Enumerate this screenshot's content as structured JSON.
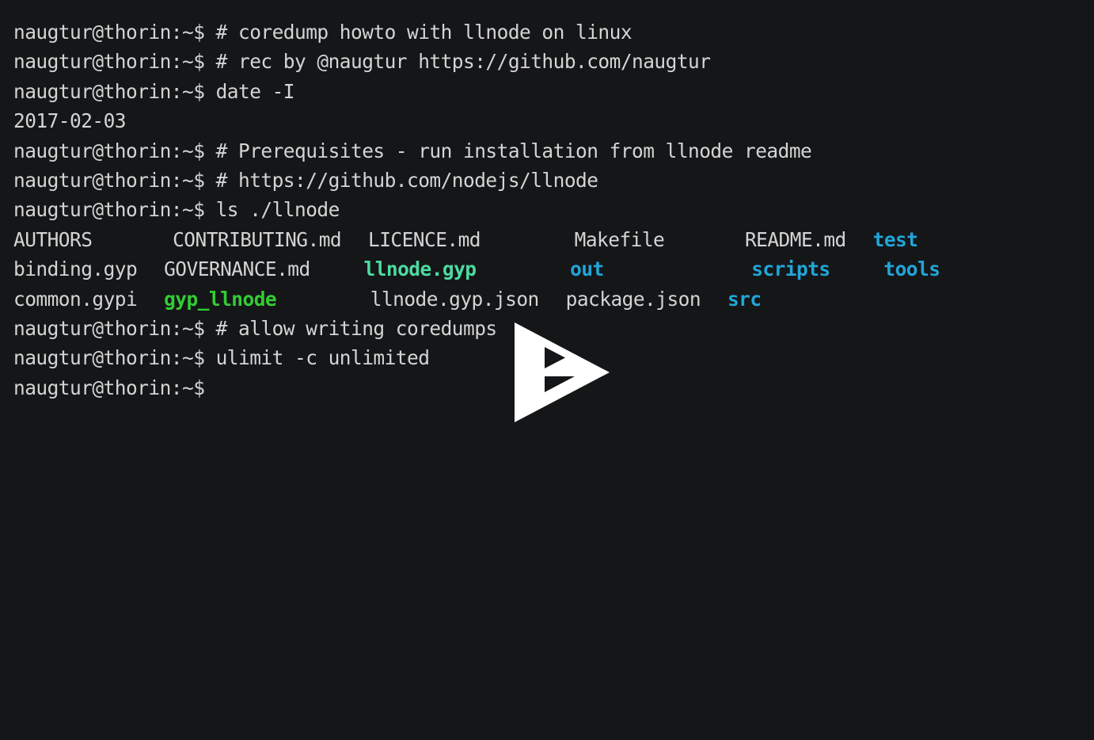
{
  "terminal": {
    "prompt": "naugtur@thorin:~$",
    "background_color": "#141618",
    "foreground_color": "#d4d4d4",
    "colors": {
      "directory": "#22a5d8",
      "symlink": "#4ddba0",
      "executable": "#33cc33",
      "text": "#d4d4d4"
    },
    "lines": [
      {
        "id": "line-1",
        "kind": "command",
        "prompt": "naugtur@thorin:~$",
        "command": " # coredump howto with llnode on linux"
      },
      {
        "id": "line-2",
        "kind": "command",
        "prompt": "naugtur@thorin:~$",
        "command": " # rec by @naugtur https://github.com/naugtur"
      },
      {
        "id": "line-3",
        "kind": "command",
        "prompt": "naugtur@thorin:~$",
        "command": " date -I"
      },
      {
        "id": "line-4",
        "kind": "output",
        "text": "2017-02-03"
      },
      {
        "id": "line-5",
        "kind": "command",
        "prompt": "naugtur@thorin:~$",
        "command": " # Prerequisites - run installation from llnode readme"
      },
      {
        "id": "line-6",
        "kind": "command",
        "prompt": "naugtur@thorin:~$",
        "command": " # https://github.com/nodejs/llnode"
      },
      {
        "id": "line-7",
        "kind": "command",
        "prompt": "naugtur@thorin:~$",
        "command": " ls ./llnode"
      },
      {
        "id": "line-8",
        "kind": "ls-row",
        "cells": [
          {
            "text": "AUTHORS",
            "type": "text",
            "col": 0
          },
          {
            "text": "CONTRIBUTING.md",
            "type": "text",
            "col": 13
          },
          {
            "text": "LICENCE.md",
            "type": "text",
            "col": 30
          },
          {
            "text": "Makefile",
            "type": "text",
            "col": 47
          },
          {
            "text": "README.md",
            "type": "text",
            "col": 61
          },
          {
            "text": "test",
            "type": "directory",
            "col": 72
          }
        ]
      },
      {
        "id": "line-9",
        "kind": "ls-row",
        "cells": [
          {
            "text": "binding.gyp",
            "type": "text",
            "col": 0
          },
          {
            "text": "GOVERNANCE.md",
            "type": "text",
            "col": 13
          },
          {
            "text": "llnode.gyp",
            "type": "symlink",
            "col": 30
          },
          {
            "text": "out",
            "type": "directory",
            "col": 47
          },
          {
            "text": "scripts",
            "type": "directory",
            "col": 61
          },
          {
            "text": "tools",
            "type": "directory",
            "col": 72
          }
        ]
      },
      {
        "id": "line-10",
        "kind": "ls-row",
        "cells": [
          {
            "text": "common.gypi",
            "type": "text",
            "col": 0
          },
          {
            "text": "gyp_llnode",
            "type": "executable",
            "col": 13
          },
          {
            "text": "llnode.gyp.json",
            "type": "text",
            "col": 30
          },
          {
            "text": "package.json",
            "type": "text",
            "col": 47
          },
          {
            "text": "src",
            "type": "directory",
            "col": 61
          }
        ]
      },
      {
        "id": "line-11",
        "kind": "command",
        "prompt": "naugtur@thorin:~$",
        "command": " # allow writing coredumps"
      },
      {
        "id": "line-12",
        "kind": "command",
        "prompt": "naugtur@thorin:~$",
        "command": " ulimit -c unlimited"
      },
      {
        "id": "line-13",
        "kind": "command",
        "prompt": "naugtur@thorin:~$",
        "command": ""
      }
    ]
  },
  "player": {
    "play_button_label": "Play",
    "play_icon": "asciinema-play-icon",
    "play_icon_color": "#ffffff"
  }
}
